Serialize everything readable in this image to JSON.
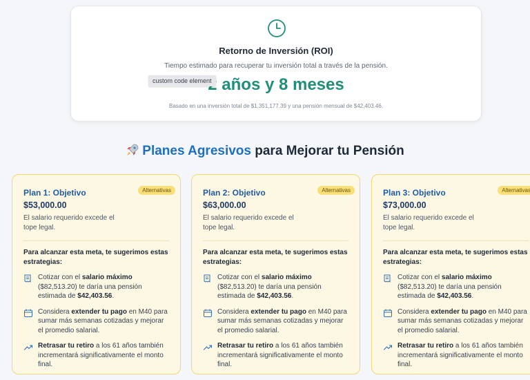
{
  "roi": {
    "icon": "clock-icon",
    "title": "Retorno de Inversión (ROI)",
    "subtitle": "Tiempo estimado para recuperar tu inversión total a través de la pensión.",
    "value": "2 años y 8 meses",
    "note": "Basado en una inversión total de $1,351,177.39 y una pensión mensual de $42,403.46.",
    "tooltip": "custom code element",
    "accent_color": "#1f8f7a"
  },
  "section": {
    "icon": "rocket-icon",
    "title_accent": "Planes Agresivos",
    "title_rest": " para Mejorar tu Pensión"
  },
  "plans": [
    {
      "title": "Plan 1: Objetivo",
      "badge": "Alternativas",
      "amount": "$53,000.00",
      "desc": "El salario requerido excede el tope legal.",
      "intro": "Para alcanzar esta meta, te sugerimos estas estrategias:",
      "s1_a": "Cotizar con el ",
      "s1_b": "salario máximo",
      "s1_c": " ($82,513.20) te daría una pensión estimada de ",
      "s1_d": "$42,403.56",
      "s1_e": ".",
      "s2_a": "Considera ",
      "s2_b": "extender tu pago",
      "s2_c": " en M40 para sumar más semanas cotizadas y mejorar el promedio salarial.",
      "s3_b": "Retrasar tu retiro",
      "s3_c": " a los 61 años también incrementará significativamente el monto final."
    },
    {
      "title": "Plan 2: Objetivo",
      "badge": "Alternativas",
      "amount": "$63,000.00",
      "desc": "El salario requerido excede el tope legal.",
      "intro": "Para alcanzar esta meta, te sugerimos estas estrategias:",
      "s1_a": "Cotizar con el ",
      "s1_b": "salario máximo",
      "s1_c": " ($82,513.20) te daría una pensión estimada de ",
      "s1_d": "$42,403.56",
      "s1_e": ".",
      "s2_a": "Considera ",
      "s2_b": "extender tu pago",
      "s2_c": " en M40 para sumar más semanas cotizadas y mejorar el promedio salarial.",
      "s3_b": "Retrasar tu retiro",
      "s3_c": " a los 61 años también incrementará significativamente el monto final."
    },
    {
      "title": "Plan 3: Objetivo",
      "badge": "Alternativas",
      "amount": "$73,000.00",
      "desc": "El salario requerido excede el tope legal.",
      "intro": "Para alcanzar esta meta, te sugerimos estas estrategias:",
      "s1_a": "Cotizar con el ",
      "s1_b": "salario máximo",
      "s1_c": " ($82,513.20) te daría una pensión estimada de ",
      "s1_d": "$42,403.56",
      "s1_e": ".",
      "s2_a": "Considera ",
      "s2_b": "extender tu pago",
      "s2_c": " en M40 para sumar más semanas cotizadas y mejorar el promedio salarial.",
      "s3_b": "Retrasar tu retiro",
      "s3_c": " a los 61 años también incrementará significativamente el monto final."
    }
  ],
  "strategy_icons": [
    "receipt-icon",
    "calendar-icon",
    "trending-up-icon"
  ]
}
